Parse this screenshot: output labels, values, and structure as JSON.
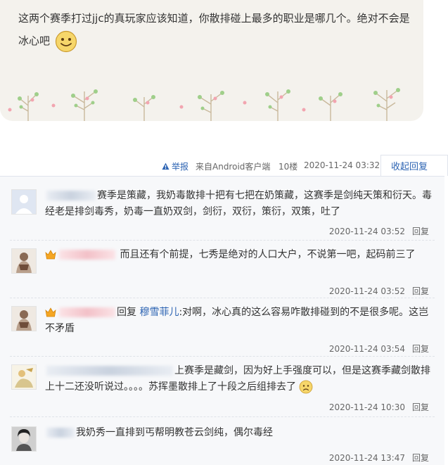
{
  "post": {
    "text": "这两个赛季打过jjc的真玩家应该知道，你散排碰上最多的职业是哪几个。绝对不会是冰心吧"
  },
  "meta": {
    "report": "举报",
    "client": "来自Android客户端",
    "floor": "10楼",
    "date": "2020-11-24 03:32",
    "collapse": "收起回复"
  },
  "replies": [
    {
      "text": "赛季是策藏，我奶毒散排十把有七把在奶策藏，这赛季是剑纯天策和衍天。毒经老是排剑毒秀，奶毒一直奶双剑，剑衍，双衍，策衍，双策，吐了",
      "time": "2020-11-24 03:52",
      "reply_label": "回复"
    },
    {
      "text": "而且还有个前提，七秀是绝对的人口大户，不说第一吧，起码前三了",
      "time": "2020-11-24 03:52",
      "reply_label": "回复"
    },
    {
      "prefix": "回复",
      "target": "穆雪菲儿",
      "text": ":对啊，冰心真的这么容易咋散排碰到的不是很多呢。这岂不矛盾",
      "time": "2020-11-24 03:54",
      "reply_label": "回复"
    },
    {
      "text": "上赛季是藏剑，因为好上手强度可以，但是这赛季藏剑散排上十二还没听说过。。。。苏挥墨散排上了十段之后组排去了",
      "time": "2020-11-24 10:30",
      "reply_label": "回复"
    },
    {
      "text": "我奶秀一直排到丐帮明教苍云剑纯，偶尔毒经",
      "time": "2020-11-24 13:47",
      "reply_label": "回复"
    }
  ],
  "colors": {
    "link": "#2d64b3",
    "card_bg": "#f4f2ed",
    "reply_bg": "#f7f8fa"
  },
  "icons": {
    "smiley": "smiley-emoji-icon",
    "report": "warning-icon",
    "crown": "member-crown-icon",
    "worried": "worried-emoji-icon"
  }
}
